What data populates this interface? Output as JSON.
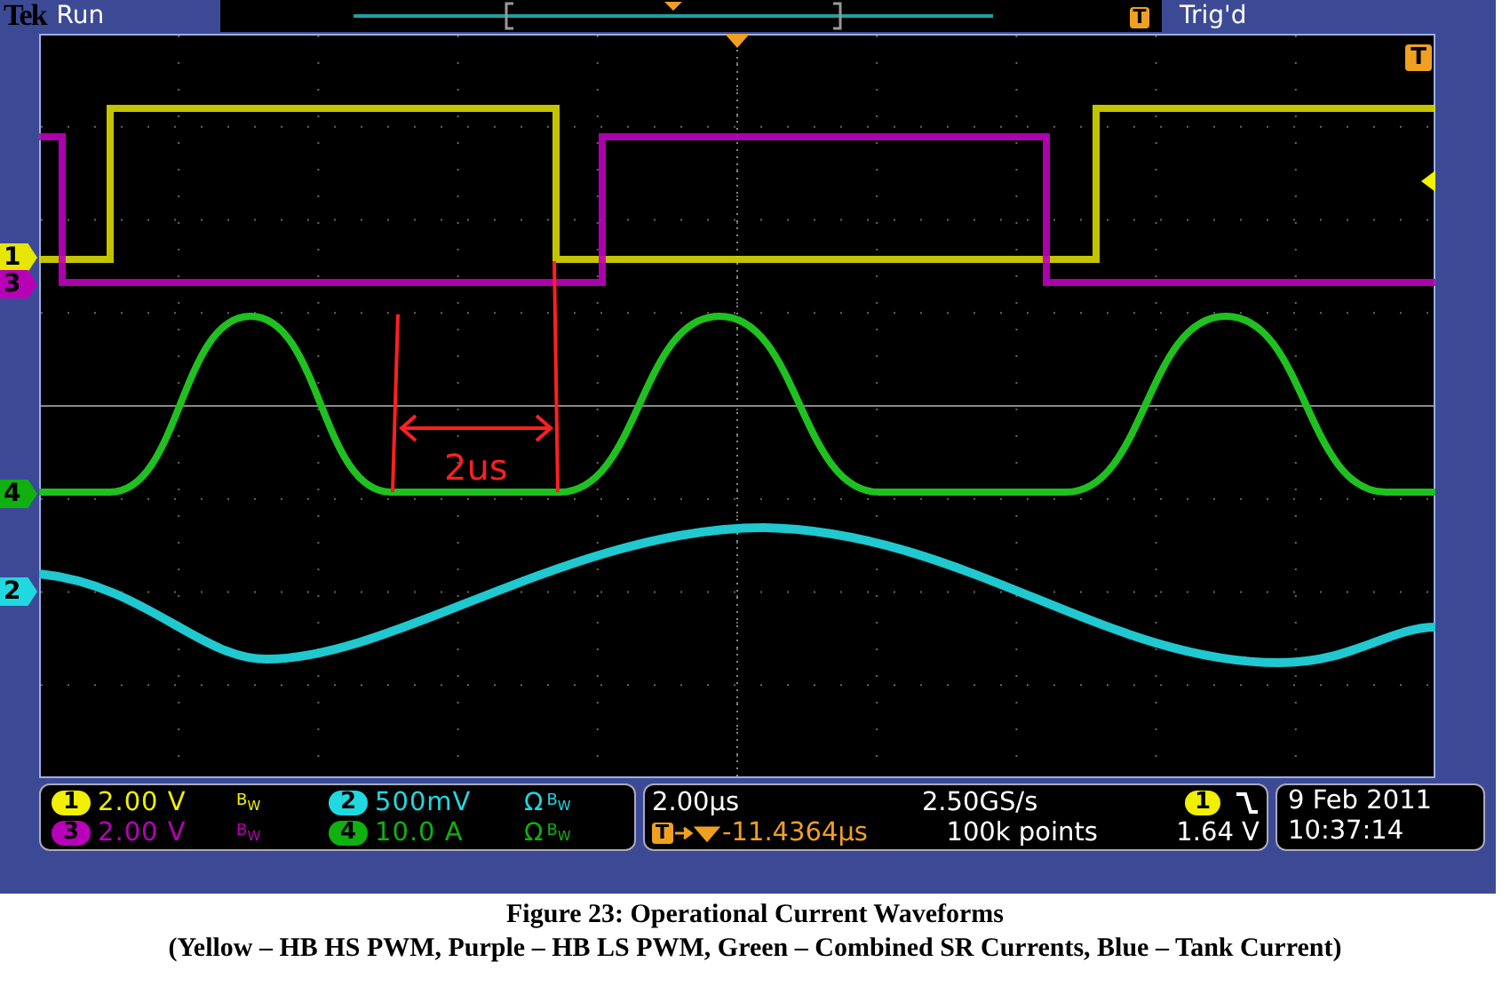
{
  "header": {
    "logo": "Tek",
    "status": "Run",
    "record_marker": "T",
    "trigger_status": "Trig'd"
  },
  "trigger_position_marker": "T",
  "channel_markers": [
    {
      "label": "1",
      "color": "#e6e600"
    },
    {
      "label": "3",
      "color": "#b800b8"
    },
    {
      "label": "4",
      "color": "#10b010"
    },
    {
      "label": "2",
      "color": "#20d8e0"
    }
  ],
  "annotation": {
    "text": "2us"
  },
  "channels": [
    {
      "number": "1",
      "color": "#f0f000",
      "scale": "2.00 V",
      "bandwidth": "B$_{W}$"
    },
    {
      "number": "2",
      "color": "#20d8e0",
      "scale": "500mV",
      "impedance": "Ω",
      "bandwidth": "B$_{W}$"
    },
    {
      "number": "3",
      "color": "#b800b8",
      "scale": "2.00 V",
      "bandwidth": "B$_{W}$"
    },
    {
      "number": "4",
      "color": "#10b010",
      "scale": "10.0 A",
      "impedance": "Ω",
      "bandwidth": "B$_{W}$"
    }
  ],
  "timebase": {
    "scale": "2.00µs",
    "sample_rate": "2.50GS/s",
    "trigger_badge": "T",
    "trigger_offset": "-11.4364µs",
    "record_length": "100k points"
  },
  "trigger": {
    "source": "1",
    "color": "#f0f000",
    "level": "1.64 V"
  },
  "datetime": {
    "date": "9 Feb 2011",
    "time": "10:37:14"
  },
  "caption": {
    "title": "Figure 23: Operational Current Waveforms",
    "legend": "(Yellow – HB HS PWM, Purple – HB LS PWM, Green – Combined SR Currents, Blue – Tank Current)"
  }
}
